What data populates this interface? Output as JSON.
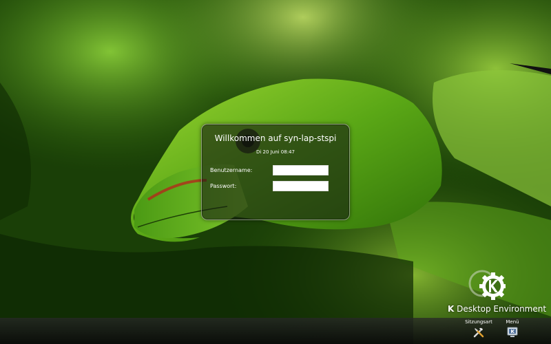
{
  "login": {
    "title": "Willkommen auf syn-lap-stspi",
    "datetime": "Di 20 Juni 08:47",
    "username_label": "Benutzername:",
    "password_label": "Passwort:",
    "username_value": "",
    "password_value": ""
  },
  "branding": {
    "k_letter": "K",
    "rest": " Desktop Environment"
  },
  "bottom_bar": {
    "session_type_label": "Sitzungsart",
    "menu_label": "Menü"
  },
  "icons": {
    "session_type": "tools-icon",
    "menu": "computer-menu-icon",
    "logo": "kde-gear-logo"
  },
  "colors": {
    "wallpaper_dark": "#0c2203",
    "wallpaper_green": "#6bb51e",
    "dialog_bg": "#161e12",
    "text": "#ffffff"
  }
}
